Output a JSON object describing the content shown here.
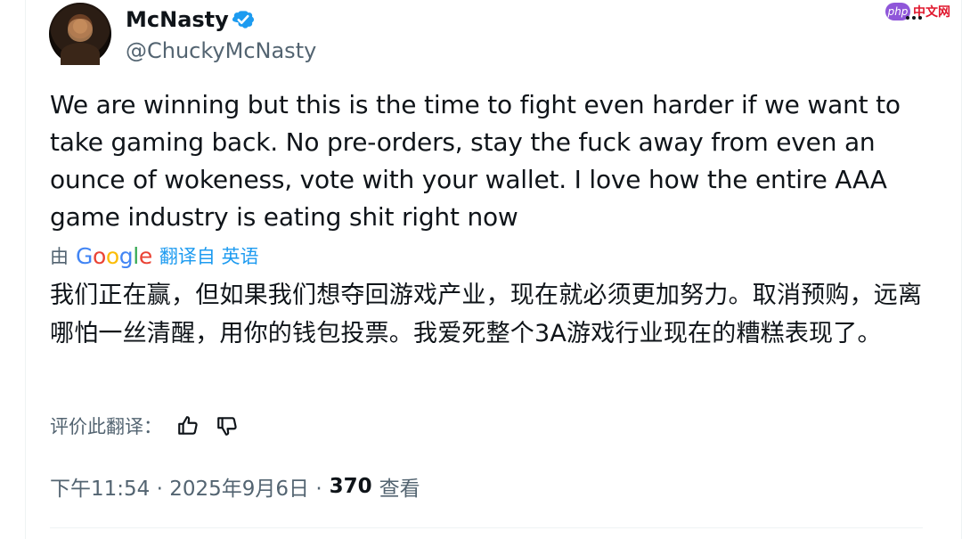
{
  "author": {
    "display_name": "McNasty",
    "handle": "@ChuckyMcNasty"
  },
  "tweet": {
    "text": "We are winning but this is the time to fight even harder if we want to take gaming back. No pre-orders, stay the fuck away from even an ounce of wokeness, vote with your wallet. I love how the entire AAA game industry is eating shit right now"
  },
  "translation": {
    "prefix": "由",
    "provider": "Google",
    "link_label": "翻译自 英语",
    "text": "我们正在赢，但如果我们想夺回游戏产业，现在就必须更加努力。取消预购，远离哪怕一丝清醒，用你的钱包投票。我爱死整个3A游戏行业现在的糟糕表现了。",
    "rate_label": "评价此翻译："
  },
  "meta": {
    "timestamp": "下午11:54 · 2025年9月6日 ·",
    "views_count": "370",
    "views_label": "查看"
  },
  "watermark": {
    "badge": "php",
    "site": "中文网"
  },
  "icons": {
    "verified": "verified-badge-icon",
    "more": "more-icon",
    "thumbs_up": "thumbs-up-icon",
    "thumbs_down": "thumbs-down-icon"
  },
  "colors": {
    "text": "#0f1419",
    "secondary_text": "#536471",
    "link": "#1d9bf0",
    "verified": "#1d9bf0"
  }
}
